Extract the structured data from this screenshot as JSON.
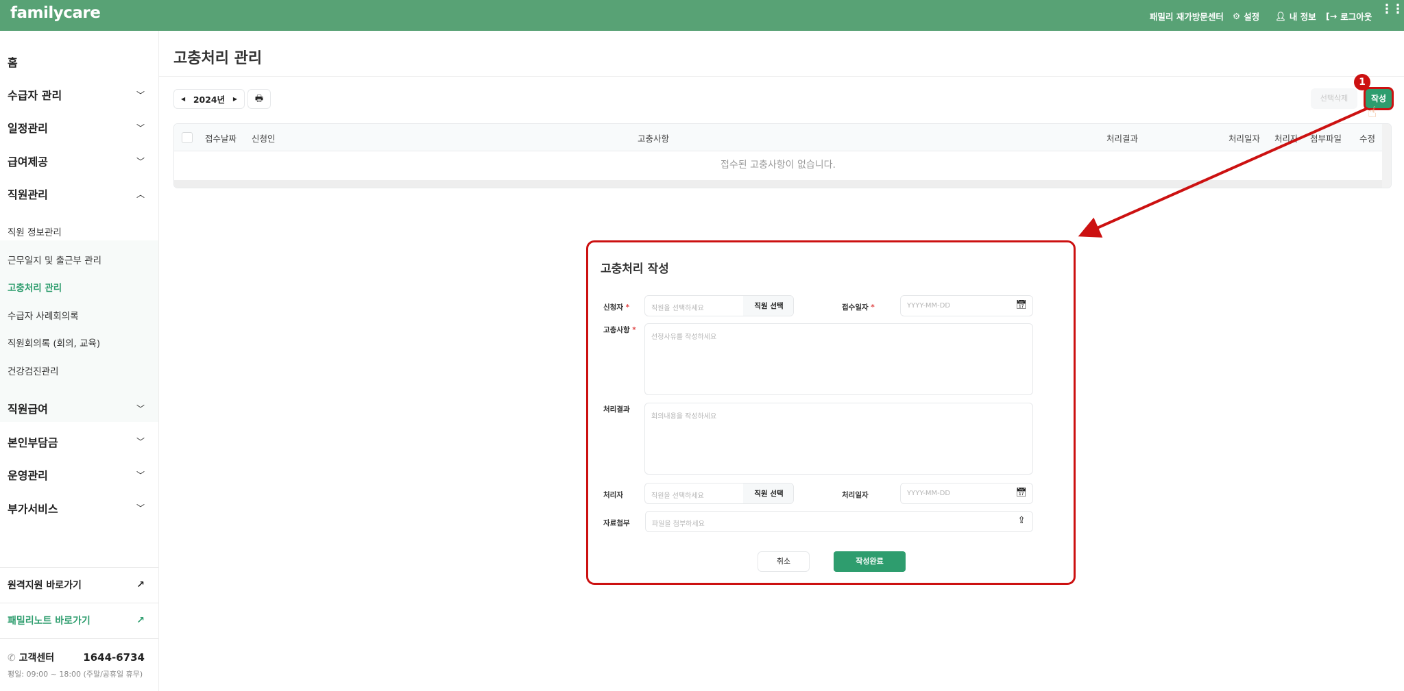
{
  "header": {
    "logo": "familycare",
    "center_name": "패밀리 재가방문센터",
    "settings": "설정",
    "my_info": "내 정보",
    "logout": "로그아웃"
  },
  "sidebar": {
    "items": [
      {
        "label": "홈"
      },
      {
        "label": "수급자 관리"
      },
      {
        "label": "일정관리"
      },
      {
        "label": "급여제공"
      },
      {
        "label": "직원관리"
      }
    ],
    "subitems": [
      {
        "label": "직원 정보관리"
      },
      {
        "label": "근무일지 및 출근부 관리"
      },
      {
        "label": "고충처리 관리",
        "active": true
      },
      {
        "label": "수급자 사례회의록"
      },
      {
        "label": "직원회의록 (회의, 교육)"
      },
      {
        "label": "건강검진관리"
      }
    ],
    "items2": [
      {
        "label": "직원급여"
      },
      {
        "label": "본인부담금"
      },
      {
        "label": "운영관리"
      },
      {
        "label": "부가서비스"
      }
    ],
    "remote_link": "원격지원 바로가기",
    "familynote_link": "패밀리노트 바로가기",
    "support_label": "고객센터",
    "support_phone": "1644-6734",
    "support_hours": "평일: 09:00 ~ 18:00 (주말/공휴일 휴무)"
  },
  "main": {
    "title": "고충처리 관리",
    "year": "2024년",
    "delete_selected": "선택삭제",
    "write": "작성",
    "step_badge": "1",
    "columns": [
      "접수날짜",
      "신청인",
      "고충사항",
      "처리결과",
      "처리일자",
      "처리자",
      "첨부파일",
      "수정"
    ],
    "empty_message": "접수된 고충사항이 없습니다."
  },
  "modal": {
    "title": "고충처리 작성",
    "applicant_label": "신청자",
    "applicant_placeholder": "직원을 선택하세요",
    "select_staff": "직원 선택",
    "received_label": "접수일자",
    "date_placeholder": "YYYY-MM-DD",
    "grievance_label": "고충사항",
    "grievance_placeholder": "선정사유를 작성하세요",
    "result_label": "처리결과",
    "result_placeholder": "회의내용을 작성하세요",
    "handler_label": "처리자",
    "handler_placeholder": "직원을 선택하세요",
    "processed_label": "처리일자",
    "attach_label": "자료첨부",
    "attach_placeholder": "파일을 첨부하세요",
    "cancel": "취소",
    "submit": "작성완료",
    "required_mark": "*"
  },
  "colors": {
    "brand": "#58a275",
    "accent": "#2e9d6e",
    "annotation": "#cc1111"
  }
}
